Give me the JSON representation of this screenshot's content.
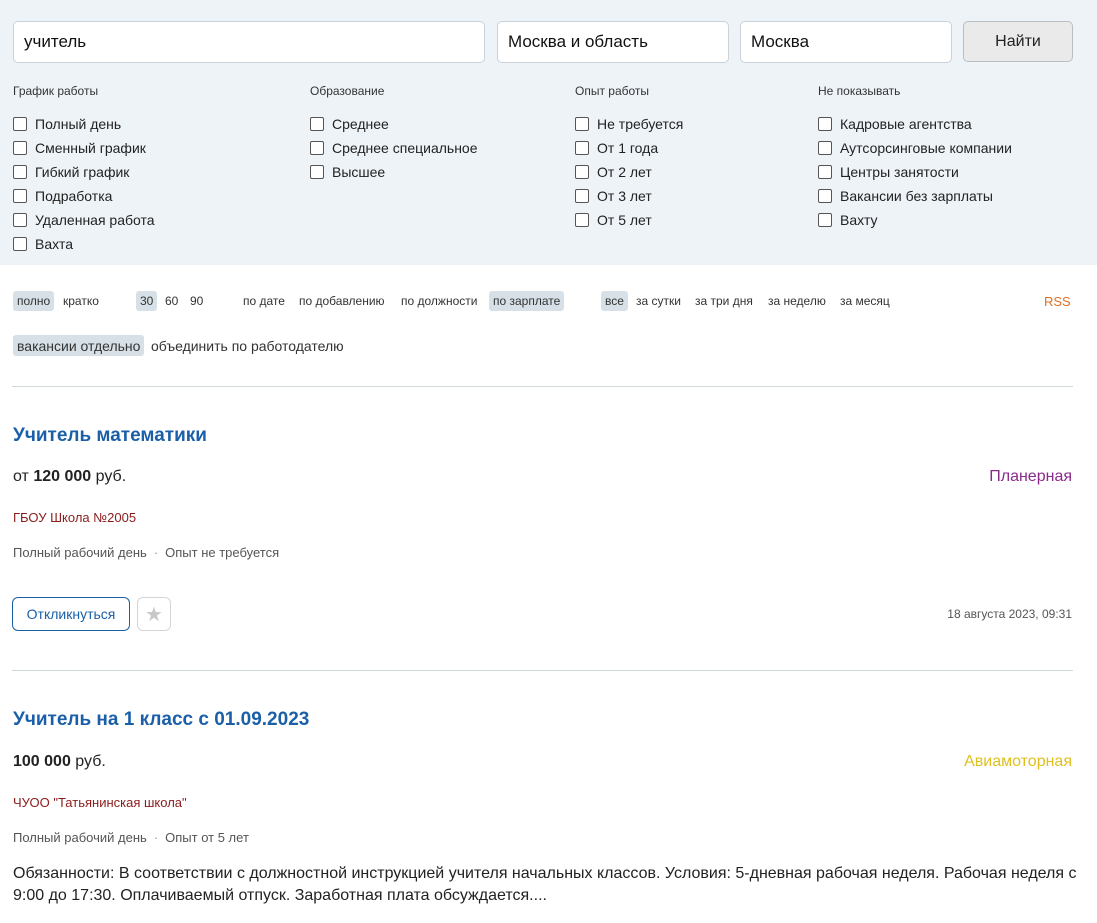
{
  "search": {
    "query": "учитель",
    "region": "Москва и область",
    "city": "Москва",
    "find_label": "Найти"
  },
  "filters": {
    "schedule": {
      "title": "График работы",
      "options": [
        "Полный день",
        "Сменный график",
        "Гибкий график",
        "Подработка",
        "Удаленная работа",
        "Вахта"
      ]
    },
    "education": {
      "title": "Образование",
      "options": [
        "Среднее",
        "Среднее специальное",
        "Высшее"
      ]
    },
    "experience": {
      "title": "Опыт работы",
      "options": [
        "Не требуется",
        "От 1 года",
        "От 2 лет",
        "От 3 лет",
        "От 5 лет"
      ]
    },
    "hide": {
      "title": "Не показывать",
      "options": [
        "Кадровые агентства",
        "Аутсорсинговые компании",
        "Центры занятости",
        "Вакансии без зарплаты",
        "Вахту"
      ]
    }
  },
  "view": {
    "full": "полно",
    "short": "кратко",
    "per_page": [
      "30",
      "60",
      "90"
    ],
    "sort": [
      "по дате",
      "по добавлению",
      "по должности",
      "по зарплате"
    ],
    "period": [
      "все",
      "за сутки",
      "за три дня",
      "за неделю",
      "за месяц"
    ],
    "rss": "RSS",
    "group_separate": "вакансии отдельно",
    "group_employer": "объединить по работодателю"
  },
  "vacancies": [
    {
      "title": "Учитель математики",
      "salary_prefix": "от",
      "salary_value": "120 000",
      "currency": "руб.",
      "metro": "Планерная",
      "metro_color": "#8b2a8b",
      "company": "ГБОУ Школа №2005",
      "schedule": "Полный рабочий день",
      "experience": "Опыт не требуется",
      "respond_label": "Откликнуться",
      "favorite_icon": "star-icon",
      "date": "18 августа 2023, 09:31"
    },
    {
      "title": "Учитель на 1 класс с 01.09.2023",
      "salary_value": "100 000",
      "currency": "руб.",
      "metro": "Авиамоторная",
      "metro_color": "#e0c020",
      "company": "ЧУОО \"Татьянинская школа\"",
      "schedule": "Полный рабочий день",
      "experience": "Опыт от 5 лет",
      "description": "Обязанности: В соответствии с должностной инструкцией учителя начальных классов. Условия: 5-дневная рабочая неделя. Рабочая неделя с 9:00 до 17:30. Оплачиваемый отпуск. Заработная плата обсуждается...."
    }
  ]
}
